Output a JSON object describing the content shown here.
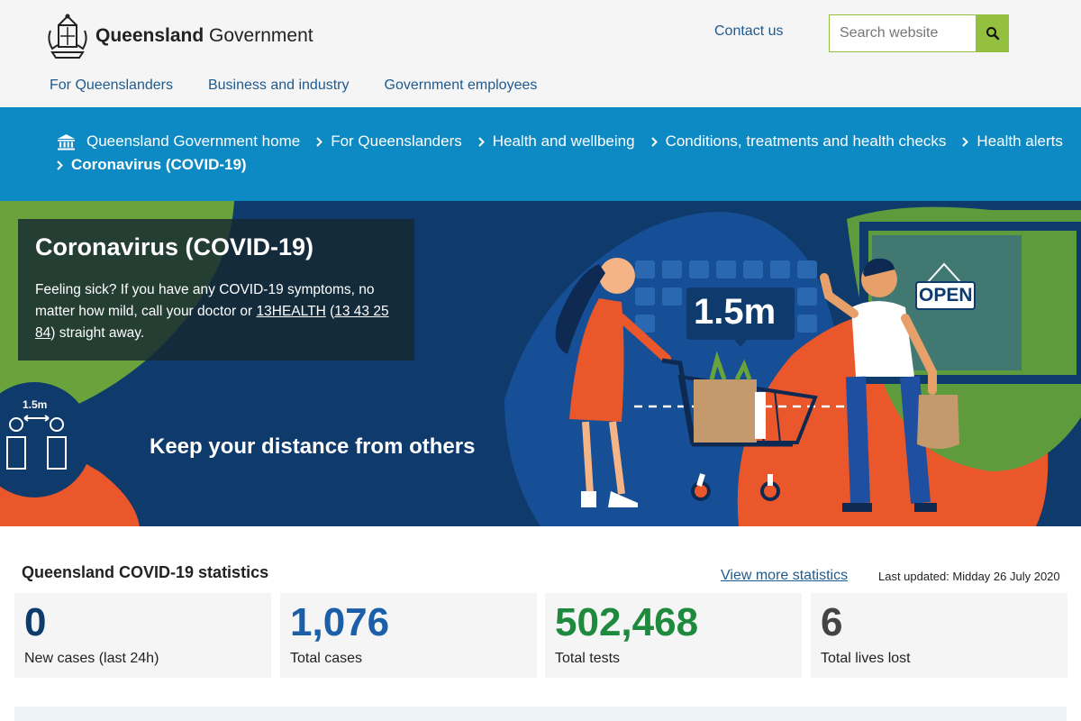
{
  "header": {
    "logo_brand": "Queensland",
    "logo_suffix": "Government",
    "contact_label": "Contact us",
    "search_placeholder": "Search website",
    "nav": [
      "For Queenslanders",
      "Business and industry",
      "Government employees"
    ]
  },
  "breadcrumb": [
    "Queensland Government home",
    "For Queenslanders",
    "Health and wellbeing",
    "Conditions, treatments and health checks",
    "Health alerts",
    "Coronavirus (COVID-19)"
  ],
  "hero": {
    "title": "Coronavirus (COVID-19)",
    "text_before": "Feeling sick? If you have any COVID-19 symptoms, no matter how mild, call your doctor or ",
    "link_13health": "13HEALTH",
    "text_paren_open": " (",
    "link_phone": "13 43 25 84",
    "text_after": ") straight away.",
    "slogan": "Keep your distance from others",
    "distance_badge": "1.5m",
    "circle_label": "1.5m",
    "sign_label": "OPEN"
  },
  "stats": {
    "title": "Queensland COVID-19 statistics",
    "more_link": "View more statistics",
    "last_updated": "Last updated: Midday 26 July 2020",
    "cards": [
      {
        "value": "0",
        "label": "New cases (last 24h)",
        "color": "#0e3a6c"
      },
      {
        "value": "1,076",
        "label": "Total cases",
        "color": "#1a5fa8"
      },
      {
        "value": "502,468",
        "label": "Total tests",
        "color": "#1e8a3e"
      },
      {
        "value": "6",
        "label": "Total lives lost",
        "color": "#444444"
      }
    ]
  },
  "colors": {
    "brand_blue": "#1f5a8f",
    "breadcrumb_bg": "#0d8ac3",
    "hero_bg": "#0e3a6c",
    "accent_green": "#94c03f",
    "accent_orange": "#e9572b"
  }
}
